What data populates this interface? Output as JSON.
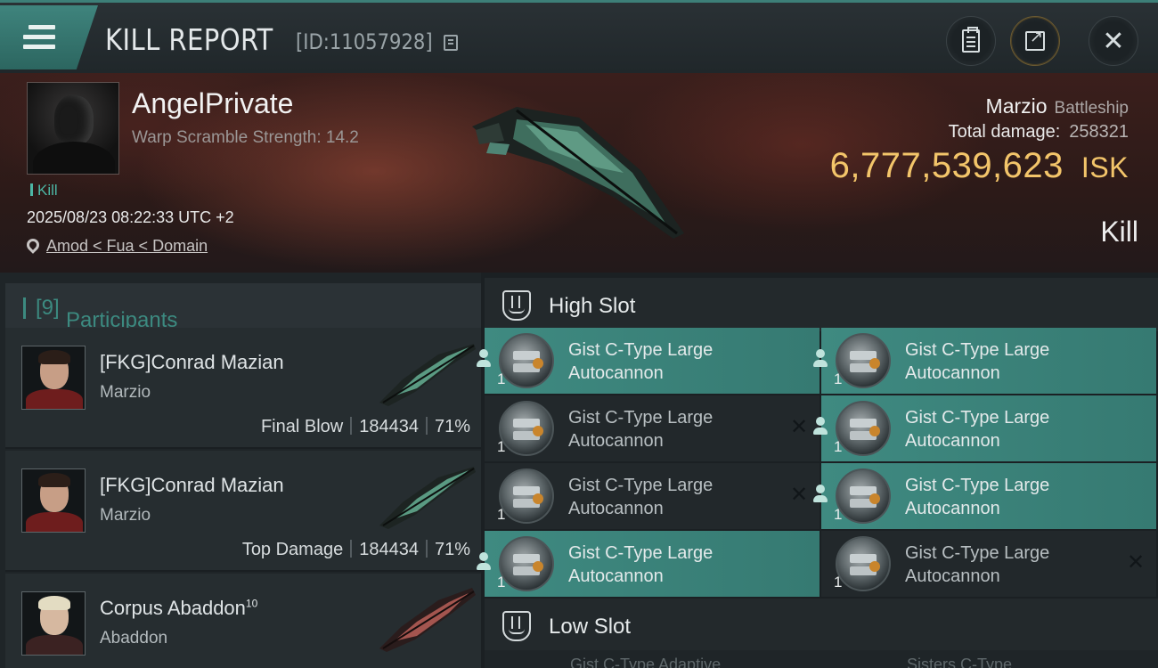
{
  "window": {
    "title": "KILL REPORT",
    "report_id": "[ID:11057928]"
  },
  "victim": {
    "name": "AngelPrivate",
    "warp_scramble": "Warp Scramble Strength: 14.2",
    "tag": "Kill",
    "timestamp": "2025/08/23 08:22:33 UTC +2",
    "location": "Amod < Fua < Domain",
    "ship": "Marzio",
    "ship_class": "Battleship",
    "total_damage_label": "Total damage:",
    "total_damage": "258321",
    "isk_value": "6,777,539,623",
    "isk_unit": "ISK",
    "result": "Kill"
  },
  "participants": {
    "label": "Participants",
    "count": "[9]",
    "rows": [
      {
        "name": "[FKG]Conrad Mazian",
        "ship": "Marzio",
        "role": "Final Blow",
        "damage": "184434",
        "percent": "71%"
      },
      {
        "name": "[FKG]Conrad Mazian",
        "ship": "Marzio",
        "role": "Top Damage",
        "damage": "184434",
        "percent": "71%"
      },
      {
        "name": "Corpus Abaddon",
        "level": "10",
        "ship": "Abaddon"
      }
    ]
  },
  "slots": {
    "high_label": "High Slot",
    "low_label": "Low Slot",
    "high_modules": [
      {
        "line1": "Gist C-Type Large",
        "line2": "Autocannon",
        "qty": "1",
        "status": "dropped"
      },
      {
        "line1": "Gist C-Type Large",
        "line2": "Autocannon",
        "qty": "1",
        "status": "dropped"
      },
      {
        "line1": "Gist C-Type Large",
        "line2": "Autocannon",
        "qty": "1",
        "status": "destroyed"
      },
      {
        "line1": "Gist C-Type Large",
        "line2": "Autocannon",
        "qty": "1",
        "status": "dropped"
      },
      {
        "line1": "Gist C-Type Large",
        "line2": "Autocannon",
        "qty": "1",
        "status": "destroyed"
      },
      {
        "line1": "Gist C-Type Large",
        "line2": "Autocannon",
        "qty": "1",
        "status": "dropped"
      },
      {
        "line1": "Gist C-Type Large",
        "line2": "Autocannon",
        "qty": "1",
        "status": "dropped"
      },
      {
        "line1": "Gist C-Type Large",
        "line2": "Autocannon",
        "qty": "1",
        "status": "destroyed"
      }
    ],
    "low_peek": [
      "Gist C-Type Adaptive",
      "Sisters C-Type"
    ]
  },
  "colors": {
    "accent": "#3f8a81",
    "isk": "#f3c56a",
    "banner": "#3b1f1c"
  },
  "icons": [
    "menu-icon",
    "copy-icon",
    "clipboard-icon",
    "share-icon",
    "close-icon",
    "location-pin-icon",
    "high-slot-icon",
    "low-slot-icon",
    "person-icon",
    "x-icon"
  ]
}
